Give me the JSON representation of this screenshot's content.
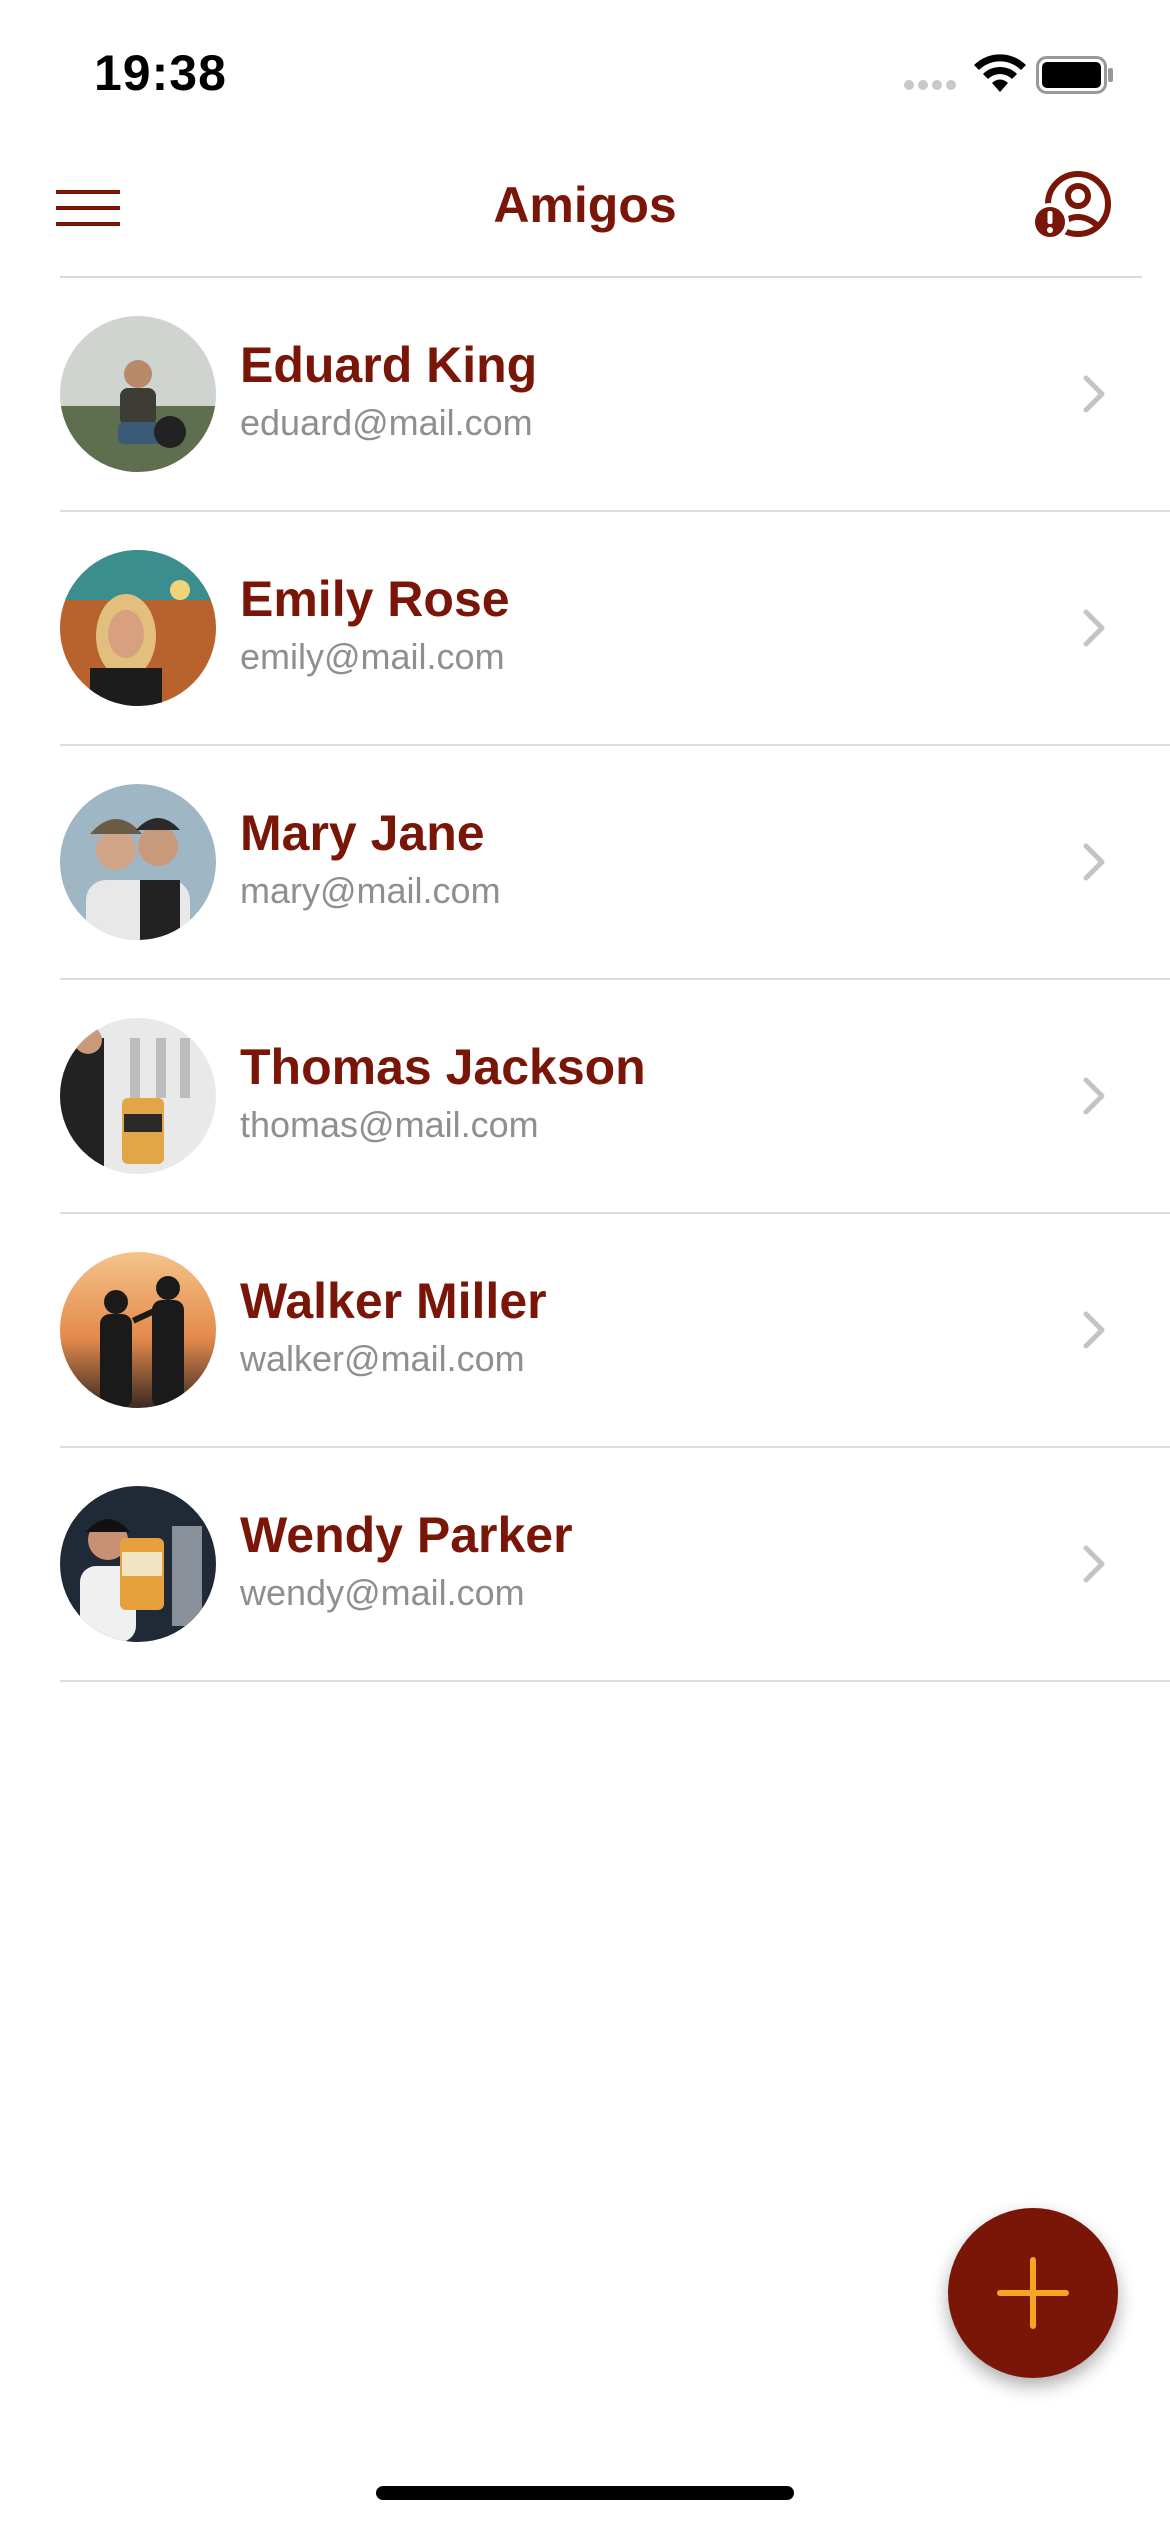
{
  "status_bar": {
    "time": "19:38"
  },
  "nav": {
    "title": "Amigos",
    "left_icon": "hamburger-menu-icon",
    "right_icon": "profile-alert-icon"
  },
  "contacts": [
    {
      "name": "Eduard King",
      "email": "eduard@mail.com"
    },
    {
      "name": "Emily Rose",
      "email": "emily@mail.com"
    },
    {
      "name": "Mary Jane",
      "email": "mary@mail.com"
    },
    {
      "name": "Thomas Jackson",
      "email": "thomas@mail.com"
    },
    {
      "name": "Walker Miller",
      "email": "walker@mail.com"
    },
    {
      "name": "Wendy Parker",
      "email": "wendy@mail.com"
    }
  ],
  "fab": {
    "icon": "plus-icon"
  },
  "colors": {
    "brand": "#7a1608",
    "accent": "#f5a623",
    "secondary_text": "#8e8e93",
    "divider": "#dcdcdc"
  }
}
